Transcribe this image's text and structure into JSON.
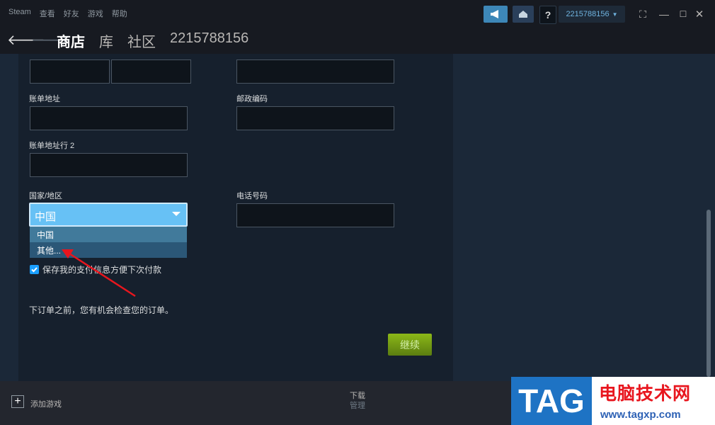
{
  "menu": [
    "Steam",
    "查看",
    "好友",
    "游戏",
    "帮助"
  ],
  "account": {
    "name": "2215788156"
  },
  "nav": {
    "tabs": [
      {
        "label": "商店",
        "active": true
      },
      {
        "label": "库",
        "active": false
      },
      {
        "label": "社区",
        "active": false
      },
      {
        "label": "2215788156",
        "active": false
      }
    ]
  },
  "form": {
    "billing_address_label": "账单地址",
    "postal_code_label": "邮政编码",
    "billing_address2_label": "账单地址行 2",
    "country_label": "国家/地区",
    "phone_label": "电话号码",
    "country_selected": "中国",
    "country_options": [
      "中国",
      "其他..."
    ],
    "save_payment_label": "保存我的支付信息方便下次付款",
    "save_payment_checked": true,
    "review_note": "下订单之前，您有机会检查您的订单。",
    "continue_label": "继续"
  },
  "bottombar": {
    "add_game": "添加游戏",
    "downloads": "下载",
    "manage": "管理"
  },
  "watermark": {
    "tag": "TAG",
    "site_name": "电脑技术网",
    "url": "www.tagxp.com"
  },
  "colors": {
    "accent": "#67c1f5",
    "continue_green": "#8cb818",
    "annotation_arrow": "#e8161e"
  }
}
